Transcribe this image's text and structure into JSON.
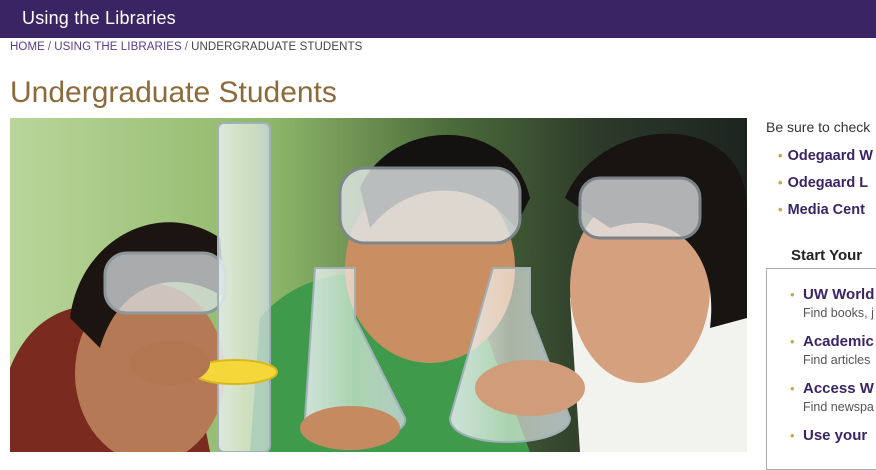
{
  "header": {
    "title": "Using the Libraries"
  },
  "breadcrumb": {
    "home": "HOME",
    "section": "USING THE LIBRARIES",
    "current": "UNDERGRADUATE STUDENTS",
    "separator": "/"
  },
  "page": {
    "title": "Undergraduate Students"
  },
  "sidebar": {
    "intro": "Be sure to check",
    "links": [
      "Odegaard W",
      "Odegaard L",
      "Media Cent"
    ],
    "start_heading": "Start Your",
    "box_items": [
      {
        "title": "UW World",
        "desc": "Find books, j"
      },
      {
        "title": "Academic",
        "desc": "Find articles"
      },
      {
        "title": "Access W",
        "desc": "Find newspa"
      },
      {
        "title": "Use your",
        "desc": ""
      }
    ]
  },
  "colors": {
    "header_bg": "#3b2464",
    "title": "#8b6b3a",
    "link": "#3b2464",
    "bullet": "#c8a84a"
  }
}
